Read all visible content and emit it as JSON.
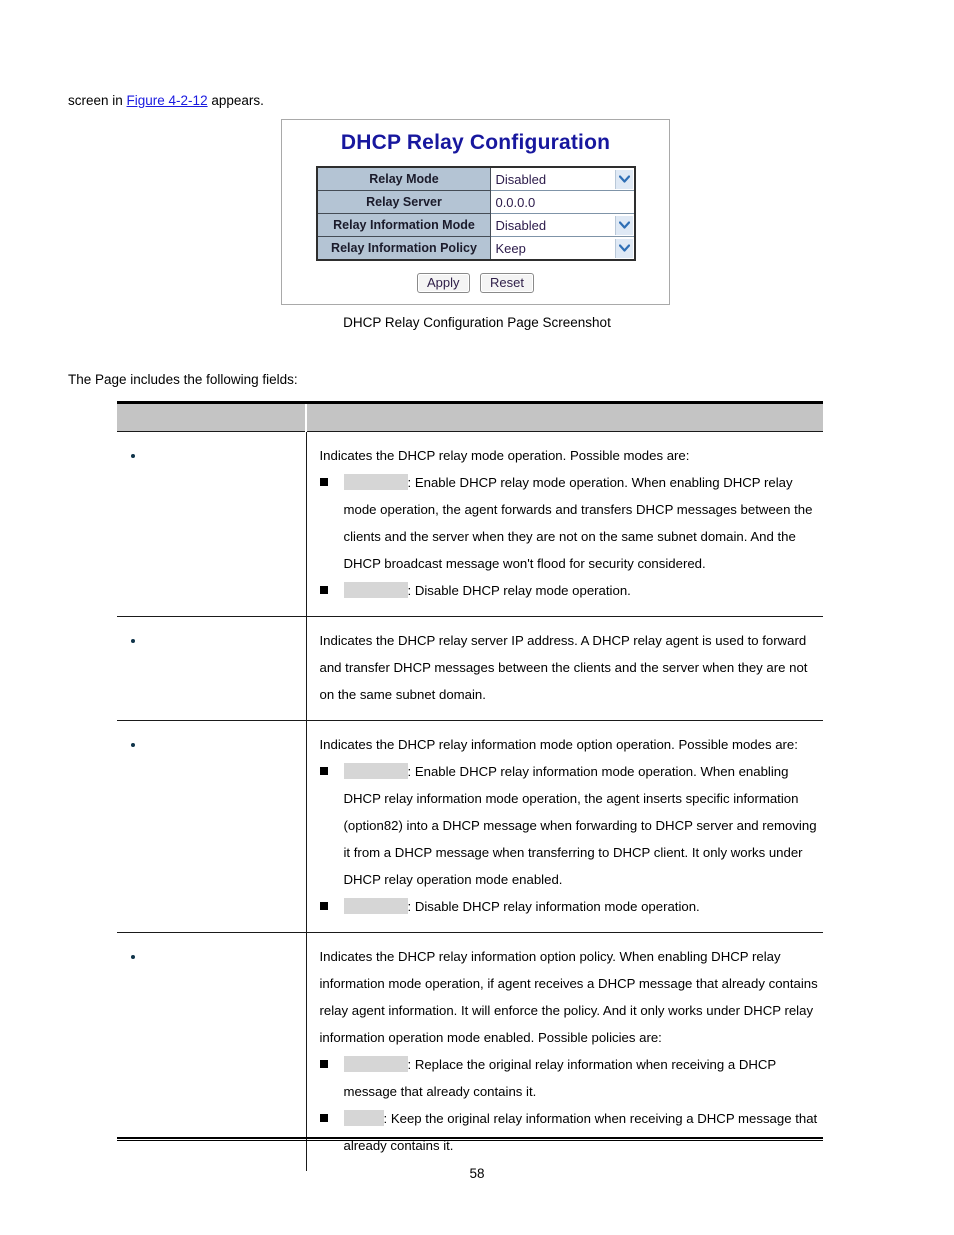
{
  "document": {
    "intro_prefix": "screen in ",
    "intro_figure_ref": "Figure 4-2-12",
    "intro_suffix": " appears.",
    "caption": "DHCP Relay Configuration Page Screenshot",
    "lead_in": "The Page includes the following fields:",
    "page_number": "58"
  },
  "screenshot": {
    "title": "DHCP Relay Configuration",
    "rows": [
      {
        "label": "Relay Mode",
        "value": "Disabled",
        "control": "select"
      },
      {
        "label": "Relay Server",
        "value": "0.0.0.0",
        "control": "text"
      },
      {
        "label": "Relay Information Mode",
        "value": "Disabled",
        "control": "select"
      },
      {
        "label": "Relay Information Policy",
        "value": "Keep",
        "control": "select"
      }
    ],
    "buttons": {
      "apply": "Apply",
      "reset": "Reset"
    },
    "colors": {
      "title": "#17179e",
      "label_bg": "#b4c4d4",
      "value_text": "#2b1a4a",
      "arrow_bg": "#dfe9f5"
    }
  },
  "fields_table": {
    "headers": {
      "object": "",
      "description": ""
    },
    "rows": [
      {
        "name": "",
        "intro": "Indicates the DHCP relay mode operation. Possible modes are:",
        "items": [
          {
            "term": "",
            "term_width": "wide",
            "text": ": Enable DHCP relay mode operation. When enabling DHCP relay mode operation, the agent forwards and transfers DHCP messages between the clients and the server when they are not on the same subnet domain. And the DHCP broadcast message won't flood for security considered."
          },
          {
            "term": "",
            "term_width": "wide",
            "text": ": Disable DHCP relay mode operation."
          }
        ]
      },
      {
        "name": "",
        "intro": "Indicates the DHCP relay server IP address. A DHCP relay agent is used to forward and transfer DHCP messages between the clients and the server when they are not on the same subnet domain.",
        "items": []
      },
      {
        "name": "",
        "intro": "Indicates the DHCP relay information mode option operation. Possible modes are:",
        "items": [
          {
            "term": "",
            "term_width": "wide",
            "text": ": Enable DHCP relay information mode operation. When enabling DHCP relay information mode operation, the agent inserts specific information (option82) into a DHCP message when forwarding to DHCP server and removing it from a DHCP message when transferring to DHCP client. It only works under DHCP relay operation mode enabled."
          },
          {
            "term": "",
            "term_width": "wide",
            "text": ": Disable DHCP relay information mode operation."
          }
        ]
      },
      {
        "name": "",
        "intro": "Indicates the DHCP relay information option policy. When enabling DHCP relay information mode operation, if agent receives a DHCP message that already contains relay agent information. It will enforce the policy. And it only works under DHCP relay information operation mode enabled. Possible policies are:",
        "items": [
          {
            "term": "",
            "term_width": "wide",
            "text": ": Replace the original relay information when receiving a DHCP message that already contains it."
          },
          {
            "term": "",
            "term_width": "narrow",
            "text": ": Keep the original relay information when receiving a DHCP message that already contains it."
          }
        ]
      }
    ]
  }
}
